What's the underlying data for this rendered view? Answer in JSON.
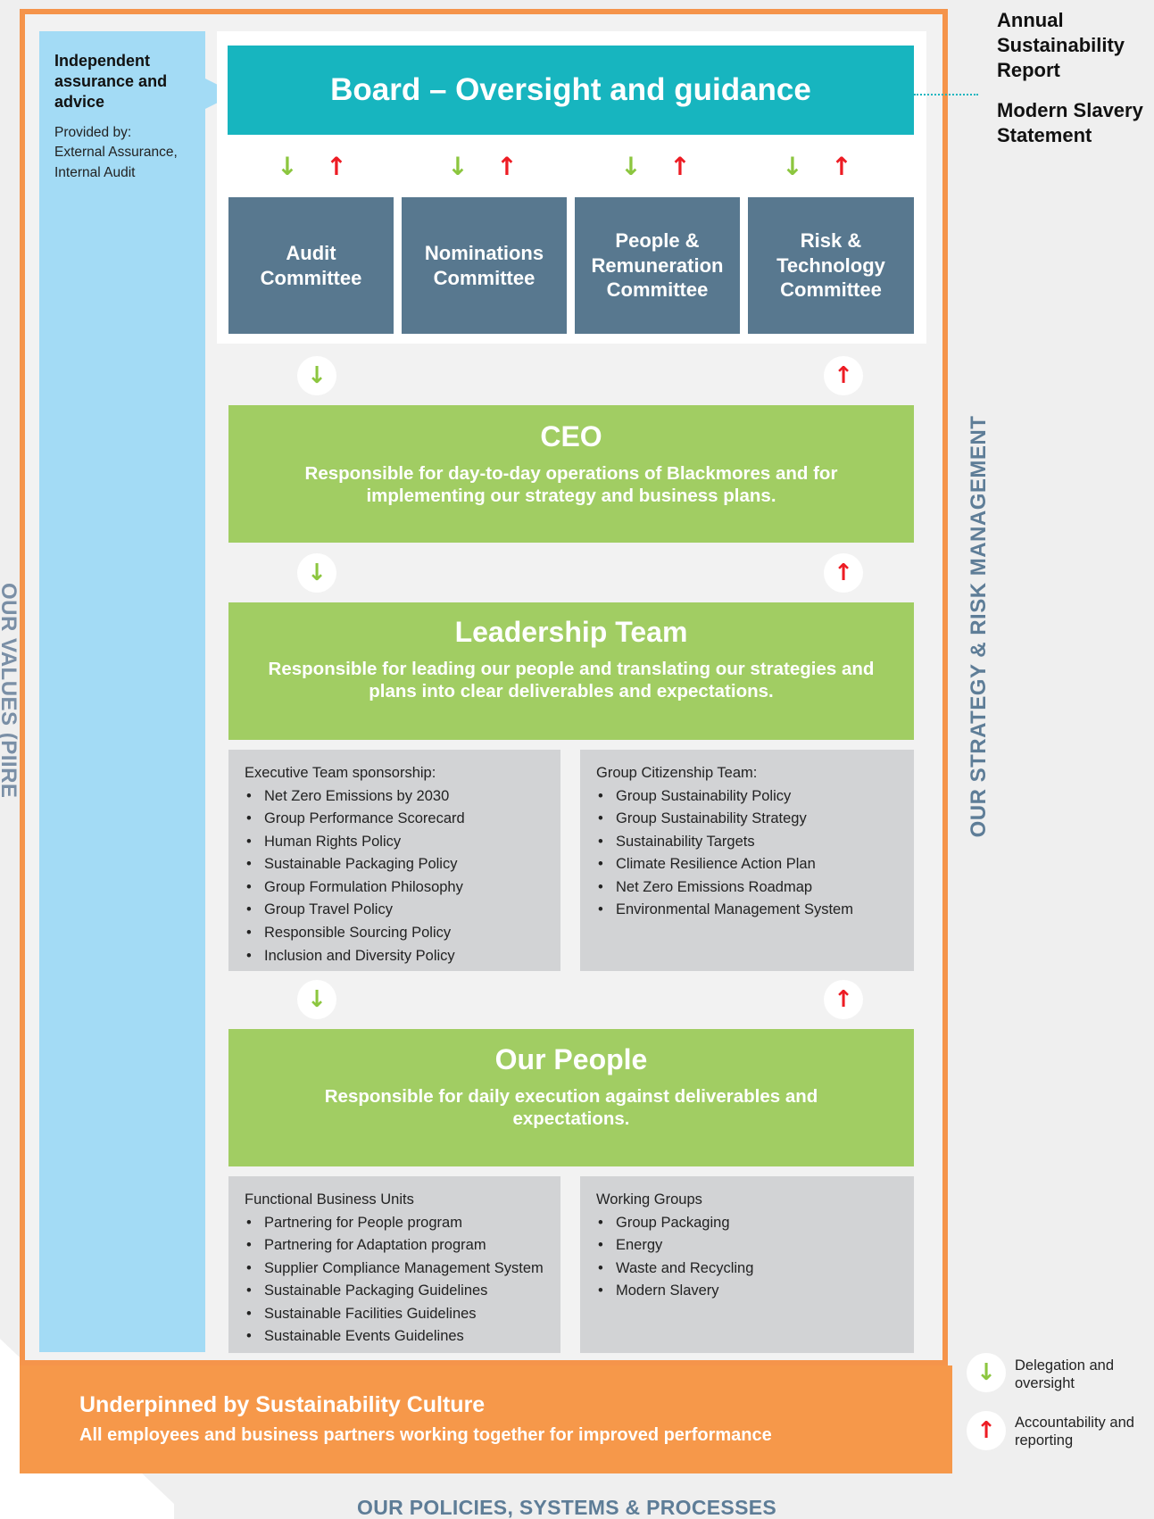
{
  "side_labels": {
    "values": "OUR VALUES (PIIRES)",
    "strategy": "OUR STRATEGY & RISK MANAGEMENT",
    "policies": "OUR POLICIES, SYSTEMS & PROCESSES"
  },
  "assurance": {
    "title": "Independent assurance and advice",
    "provided_by": "Provided by:",
    "providers": "External Assurance, Internal Audit"
  },
  "board": {
    "title": "Board – Oversight and guidance"
  },
  "reports": [
    "Annual Sustainability Report",
    "Modern Slavery Statement"
  ],
  "committees": [
    "Audit Committee",
    "Nominations Committee",
    "People & Remuneration Committee",
    "Risk & Technology Committee"
  ],
  "arrows": {
    "down": "↓",
    "up": "↑"
  },
  "ceo": {
    "title": "CEO",
    "description": "Responsible for day-to-day operations of Blackmores and for implementing our strategy and business plans."
  },
  "leadership": {
    "title": "Leadership Team",
    "description": "Responsible for leading our people and translating our strategies and plans into clear deliverables and expectations."
  },
  "executive_sponsorship": {
    "heading": "Executive Team sponsorship:",
    "items": [
      "Net Zero Emissions by 2030",
      "Group Performance Scorecard",
      "Human Rights Policy",
      "Sustainable Packaging Policy",
      "Group Formulation Philosophy",
      "Group Travel Policy",
      "Responsible Sourcing Policy",
      "Inclusion and Diversity Policy"
    ]
  },
  "citizenship_team": {
    "heading": "Group Citizenship Team:",
    "items": [
      "Group Sustainability Policy",
      "Group Sustainability Strategy",
      "Sustainability Targets",
      "Climate Resilience Action Plan",
      "Net Zero Emissions Roadmap",
      "Environmental Management System"
    ]
  },
  "our_people": {
    "title": "Our People",
    "description": "Responsible for daily execution against deliverables and expectations."
  },
  "business_units": {
    "heading": "Functional Business Units",
    "items": [
      "Partnering for People program",
      "Partnering for Adaptation program",
      "Supplier Compliance Management System",
      "Sustainable Packaging Guidelines",
      "Sustainable Facilities Guidelines",
      "Sustainable Events Guidelines"
    ]
  },
  "working_groups": {
    "heading": "Working Groups",
    "items": [
      "Group Packaging",
      "Energy",
      "Waste and Recycling",
      "Modern Slavery"
    ]
  },
  "culture": {
    "title": "Underpinned by Sustainability Culture",
    "subtitle": "All employees and business partners working together for improved performance"
  },
  "legend": {
    "delegation": "Delegation and oversight",
    "accountability": "Accountability and reporting"
  },
  "colors": {
    "board": "#17b5bf",
    "committee": "#58788f",
    "green": "#a1cd63",
    "orange": "#f6984a",
    "blue": "#a3dbf5",
    "arrow_down": "#8cc63f",
    "arrow_up": "#ed1c24"
  }
}
